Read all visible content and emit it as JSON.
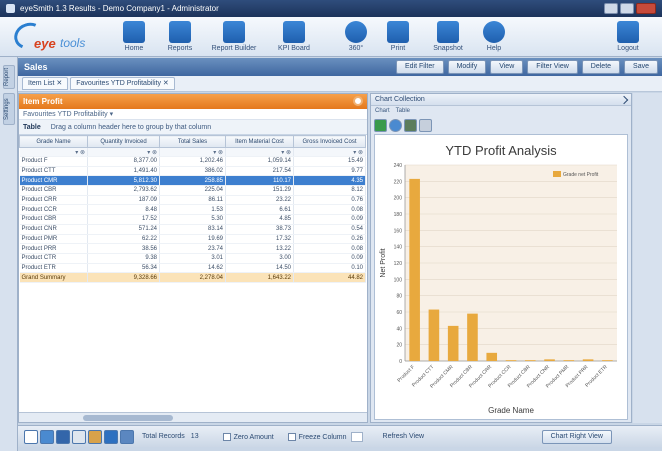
{
  "window": {
    "title": "eyeSmith 1.3 Results - Demo Company1 - Administrator"
  },
  "logo": {
    "text_main": "eye",
    "text_sub": "tools"
  },
  "toolbar": {
    "items": [
      {
        "label": "Home",
        "icon": "home-icon"
      },
      {
        "label": "Reports",
        "icon": "reports-icon"
      },
      {
        "label": "Report Builder",
        "icon": "report-builder-icon"
      },
      {
        "label": "KPI Board",
        "icon": "kpi-board-icon"
      },
      {
        "label": "360°",
        "icon": "360-icon"
      },
      {
        "label": "Print",
        "icon": "print-icon"
      },
      {
        "label": "Snapshot",
        "icon": "snapshot-icon"
      },
      {
        "label": "Help",
        "icon": "help-icon"
      }
    ],
    "logout_label": "Logout"
  },
  "sidebar": {
    "tabs": [
      "Report",
      "Settings"
    ]
  },
  "main": {
    "title": "Sales",
    "header_buttons": [
      "Edit Filter",
      "Modify",
      "View",
      "Filter View",
      "Delete",
      "Save"
    ],
    "subtabs": [
      "Item List ✕",
      "Favourites YTD Profitability ✕"
    ]
  },
  "grid_panel": {
    "title": "Item Profit",
    "breadcrumb": "Favourites YTD Profitability ▾",
    "group_label": "Table",
    "group_hint": "Drag a column header here to group by that column",
    "columns": [
      "Grade Name",
      "Quantity Invoiced",
      "Total Sales",
      "Item Material Cost",
      "Gross Invoiced Cost"
    ],
    "rows": [
      [
        "Product F",
        "8,377.00",
        "1,202.46",
        "1,059.14",
        "15.49"
      ],
      [
        "Product CTT",
        "1,491.40",
        "386.02",
        "217.54",
        "9.77"
      ],
      [
        "Product CMR",
        "5,812.30",
        "258.85",
        "110.17",
        "4.35"
      ],
      [
        "Product CBR",
        "2,793.62",
        "225.04",
        "151.29",
        "8.12"
      ],
      [
        "Product CRR",
        "187.09",
        "86.11",
        "23.22",
        "0.76"
      ],
      [
        "Product CCR",
        "8.48",
        "1.53",
        "6.61",
        "0.08"
      ],
      [
        "Product CBR",
        "17.52",
        "5.30",
        "4.85",
        "0.09"
      ],
      [
        "Product CNR",
        "571.24",
        "83.14",
        "38.73",
        "0.54"
      ],
      [
        "Product PMR",
        "62.22",
        "19.69",
        "17.32",
        "0.26"
      ],
      [
        "Product PRR",
        "38.56",
        "23.74",
        "13.22",
        "0.08"
      ],
      [
        "Product CTR",
        "9.38",
        "3.01",
        "3.00",
        "0.09"
      ],
      [
        "Product ETR",
        "56.34",
        "14.62",
        "14.50",
        "0.10"
      ]
    ],
    "totals": [
      "Grand Summary",
      "9,328.66",
      "2,278.04",
      "1,643.22",
      "44.82"
    ]
  },
  "chart_panel": {
    "header": "Chart Collection",
    "tabs": [
      "Chart",
      "Table"
    ],
    "icons": [
      "view-icon",
      "export-icon",
      "image-icon",
      "print-icon"
    ]
  },
  "chart_data": {
    "type": "bar",
    "title": "YTD Profit Analysis",
    "xlabel": "Grade Name",
    "ylabel": "Net Profit",
    "categories": [
      "Product F",
      "Product CTT",
      "Product CMR",
      "Product CBR",
      "Product CRR",
      "Product CCR",
      "Product CBR",
      "Product CNR",
      "Product PMR",
      "Product PRR",
      "Product ETR"
    ],
    "series": [
      {
        "name": "Grade net Profit",
        "values": [
          223,
          63,
          43,
          58,
          10,
          1,
          1,
          2,
          1,
          2,
          1
        ]
      }
    ],
    "ylim": [
      0,
      240
    ],
    "yticks": [
      0,
      20,
      40,
      60,
      80,
      100,
      120,
      140,
      160,
      180,
      200,
      220,
      240
    ],
    "grid": true,
    "legend": "top-right",
    "bar_color": "#e8a93e"
  },
  "statusbar": {
    "total_records_label": "Total Records",
    "total_records_value": "13",
    "zero_amount_label": "Zero Amount",
    "freeze_columns_label": "Freeze Column",
    "refresh_label": "Refresh View",
    "chart_right_label": "Chart Right View"
  }
}
